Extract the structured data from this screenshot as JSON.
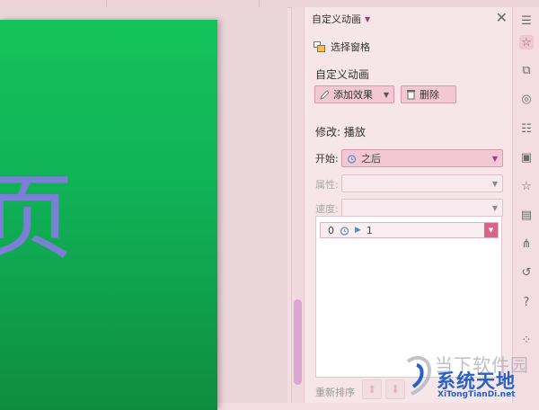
{
  "panel": {
    "title": "自定义动画",
    "selection_pane": "选择窗格",
    "section_title": "自定义动画",
    "add_effect": "添加效果",
    "delete": "删除",
    "modify": "修改: 播放",
    "start_label": "开始:",
    "start_value": "之后",
    "property_label": "属性:",
    "speed_label": "速度:",
    "list_items": [
      {
        "index": "0",
        "order": "1"
      }
    ],
    "reorder": "重新排序"
  },
  "slide": {
    "text": "页"
  },
  "watermark": {
    "top": "当下软件园",
    "main": "系统天地",
    "url": "XiTongTianDi.net"
  },
  "colors": {
    "accent": "#d86487",
    "slide_green": "#10b156",
    "slide_text": "#7b7fd6",
    "brand_blue": "#2761c8"
  }
}
